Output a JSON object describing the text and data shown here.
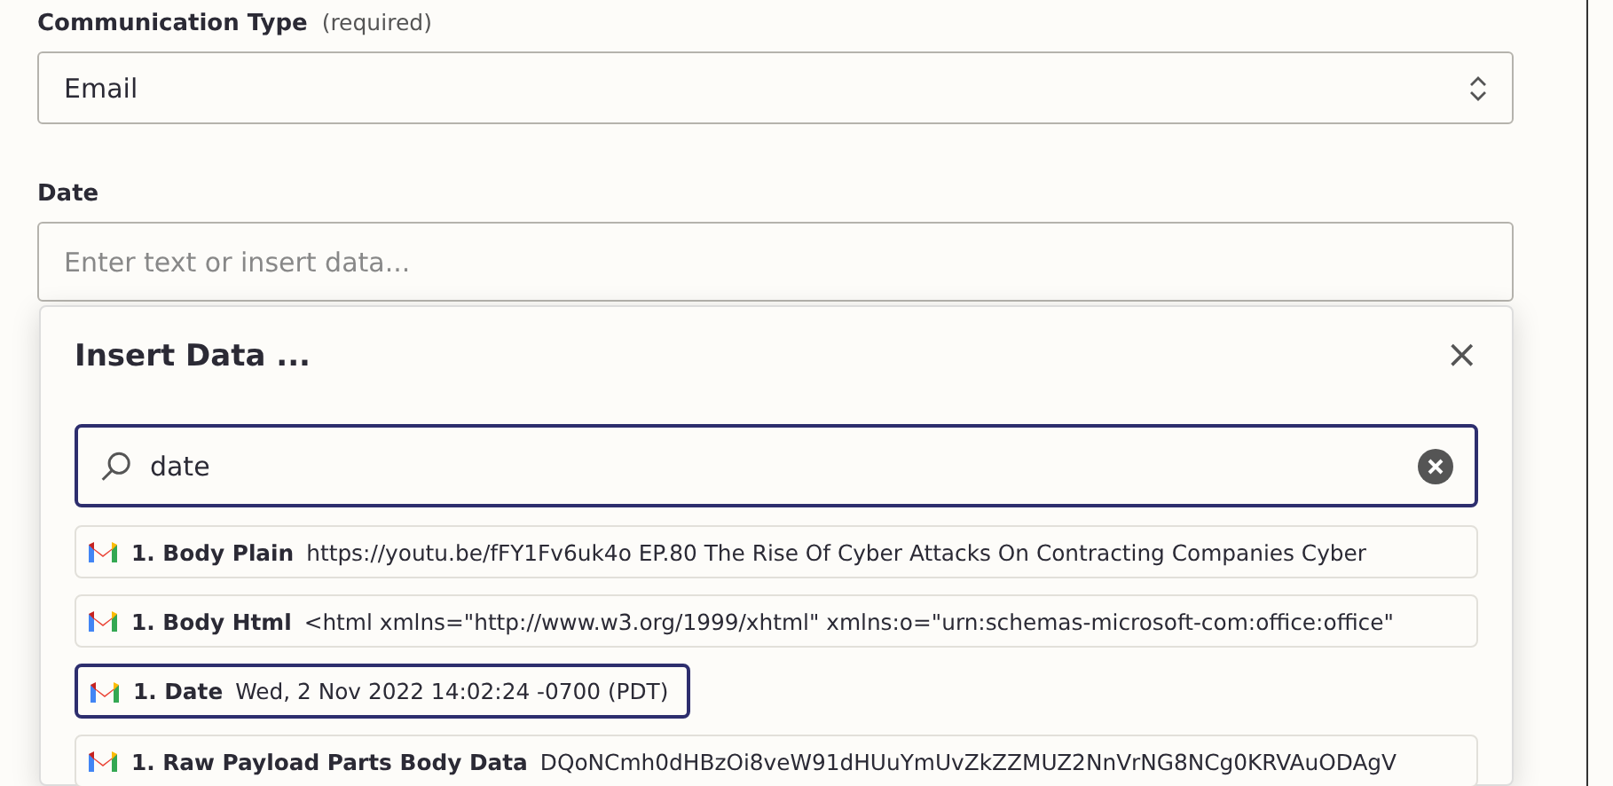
{
  "fields": [
    {
      "kind": "select",
      "label": "Communication Type",
      "note": "(required)",
      "value": "Email"
    },
    {
      "kind": "text",
      "label": "Date",
      "placeholder": "Enter text or insert data..."
    }
  ],
  "popup": {
    "title": "Insert Data ...",
    "close": "×",
    "search": {
      "value": "date"
    },
    "items": [
      {
        "name": "1. Body Plain",
        "value": "https://youtu.be/fFY1Fv6uk4o EP.80 The Rise Of Cyber Attacks On Contracting Companies Cyber",
        "selected": false
      },
      {
        "name": "1. Body Html",
        "value": "<html xmlns=\"http://www.w3.org/1999/xhtml\" xmlns:o=\"urn:schemas-microsoft-com:office:office\"",
        "selected": false
      },
      {
        "name": "1. Date",
        "value": "Wed, 2 Nov 2022 14:02:24 -0700 (PDT)",
        "selected": true
      },
      {
        "name": "1. Raw Payload Parts Body Data",
        "value": "DQoNCmh0dHBzOi8veW91dHUuYmUvZkZZMUZ2NnVrNG8NCg0KRVAuODAgV",
        "selected": false
      }
    ]
  }
}
